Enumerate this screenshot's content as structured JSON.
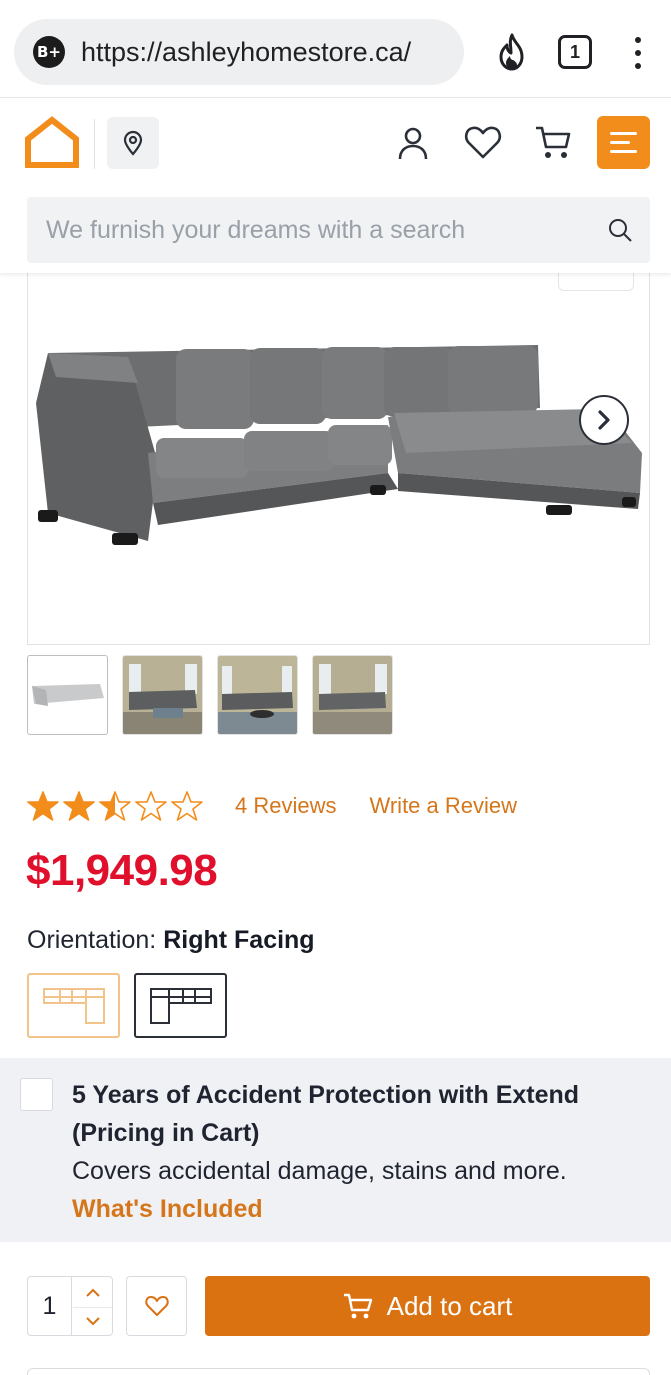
{
  "browser": {
    "site_badge": "B+",
    "url": "https://ashleyhomestore.ca/",
    "tab_count": "1"
  },
  "header": {
    "search": {
      "placeholder": "We furnish your dreams with a search"
    }
  },
  "gallery": {
    "thumbnail_count": 4,
    "active_index": 0
  },
  "product": {
    "rating": 2.5,
    "rating_max": 5,
    "reviews_label": "4 Reviews",
    "write_review_label": "Write a Review",
    "price": "$1,949.98",
    "orientation_label": "Orientation:",
    "orientation_value": "Right Facing"
  },
  "protection": {
    "title": "5 Years of Accident Protection with Extend (Pricing in Cart)",
    "description": "Covers accidental damage, stains and more.",
    "link": "What's Included",
    "checked": false
  },
  "purchase": {
    "quantity": "1",
    "add_to_cart_label": "Add to cart"
  },
  "colors": {
    "brand_orange": "#f28c1b",
    "button_orange": "#db7212",
    "link_orange": "#d5761b",
    "price_red": "#e0102d"
  }
}
